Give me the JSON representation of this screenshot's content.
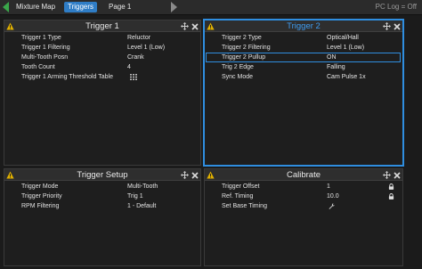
{
  "topbar": {
    "tabs": [
      {
        "label": "Mixture Map",
        "active": false
      },
      {
        "label": "Triggers",
        "active": true
      },
      {
        "label": "Page 1",
        "active": false
      }
    ],
    "status": "PC Log = Off"
  },
  "panels": {
    "trigger1": {
      "title": "Trigger 1",
      "rows": [
        {
          "label": "Trigger 1 Type",
          "value": "Reluctor"
        },
        {
          "label": "Trigger 1 Filtering",
          "value": "Level 1 (Low)"
        },
        {
          "label": "Multi-Tooth Posn",
          "value": "Crank"
        },
        {
          "label": "Tooth Count",
          "value": "4"
        },
        {
          "label": "Trigger 1 Arming Threshold Table",
          "value": ""
        }
      ]
    },
    "trigger2": {
      "title": "Trigger 2",
      "rows": [
        {
          "label": "Trigger 2 Type",
          "value": "Optical/Hall"
        },
        {
          "label": "Trigger 2 Filtering",
          "value": "Level 1 (Low)"
        },
        {
          "label": "Trigger 2 Pullup",
          "value": "ON"
        },
        {
          "label": "Trig 2 Edge",
          "value": "Falling"
        },
        {
          "label": "Sync Mode",
          "value": "Cam Pulse 1x"
        }
      ]
    },
    "triggerSetup": {
      "title": "Trigger Setup",
      "rows": [
        {
          "label": "Trigger Mode",
          "value": "Multi-Tooth"
        },
        {
          "label": "Trigger Priority",
          "value": "Trig 1"
        },
        {
          "label": "RPM Filtering",
          "value": "1 - Default"
        }
      ]
    },
    "calibrate": {
      "title": "Calibrate",
      "rows": [
        {
          "label": "Trigger Offset",
          "value": "1"
        },
        {
          "label": "Ref. Timing",
          "value": "10.0"
        },
        {
          "label": "Set Base Timing",
          "value": ""
        }
      ]
    }
  },
  "colors": {
    "accent": "#2f8ee0",
    "warning": "#e0b000",
    "tab_active": "#2f7dc6",
    "nav_arrow": "#3aa64a"
  },
  "icons": [
    "nav-left-arrow-icon",
    "nav-right-arrow-icon",
    "warning-icon",
    "move-icon",
    "close-icon",
    "table-grid-icon",
    "lock-icon",
    "wrench-icon"
  ]
}
